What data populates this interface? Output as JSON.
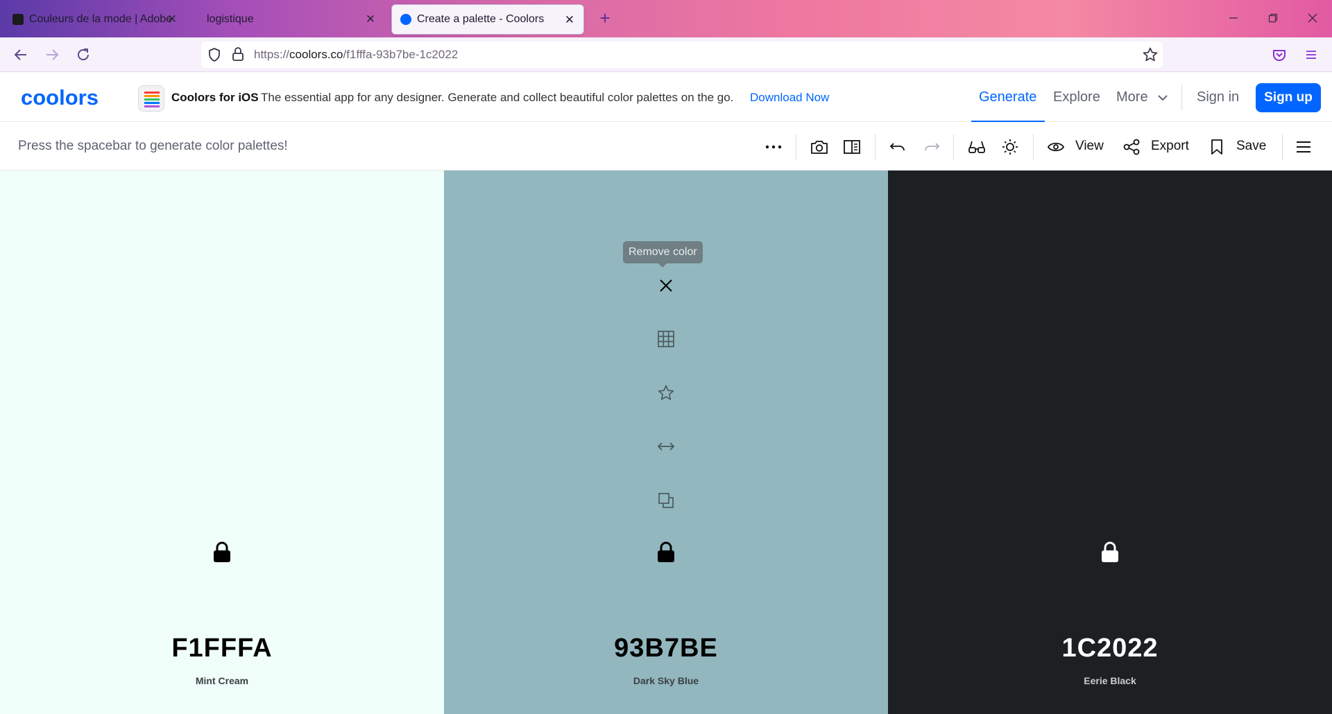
{
  "browser": {
    "tabs": [
      {
        "title": "Couleurs de la mode | Adobe C",
        "active": false
      },
      {
        "title": "logistique",
        "active": false
      },
      {
        "title": "Create a palette - Coolors",
        "active": true
      }
    ],
    "url_prefix": "https://",
    "url_domain": "coolors.co",
    "url_path": "/f1fffa-93b7be-1c2022",
    "new_tab_icon": "plus-icon"
  },
  "header": {
    "logo": "coolors",
    "promo": {
      "title": "Coolors for iOS",
      "text": "The essential app for any designer. Generate and collect beautiful color palettes on the go.",
      "link": "Download Now"
    },
    "nav": {
      "generate": "Generate",
      "explore": "Explore",
      "more": "More",
      "signin": "Sign in",
      "signup": "Sign up"
    }
  },
  "toolbar": {
    "hint": "Press the spacebar to generate color palettes!",
    "view": "View",
    "export": "Export",
    "save": "Save"
  },
  "palette": {
    "tooltip": "Remove color",
    "colors": [
      {
        "hex": "F1FFFA",
        "name": "Mint Cream",
        "bg": "#F1FFFA",
        "text": "#000000"
      },
      {
        "hex": "93B7BE",
        "name": "Dark Sky Blue",
        "bg": "#93B7BE",
        "text": "#000000"
      },
      {
        "hex": "1C2022",
        "name": "Eerie Black",
        "bg": "#1C2022",
        "text": "#FFFFFF"
      }
    ]
  },
  "colors": {
    "accent": "#0066FF"
  }
}
